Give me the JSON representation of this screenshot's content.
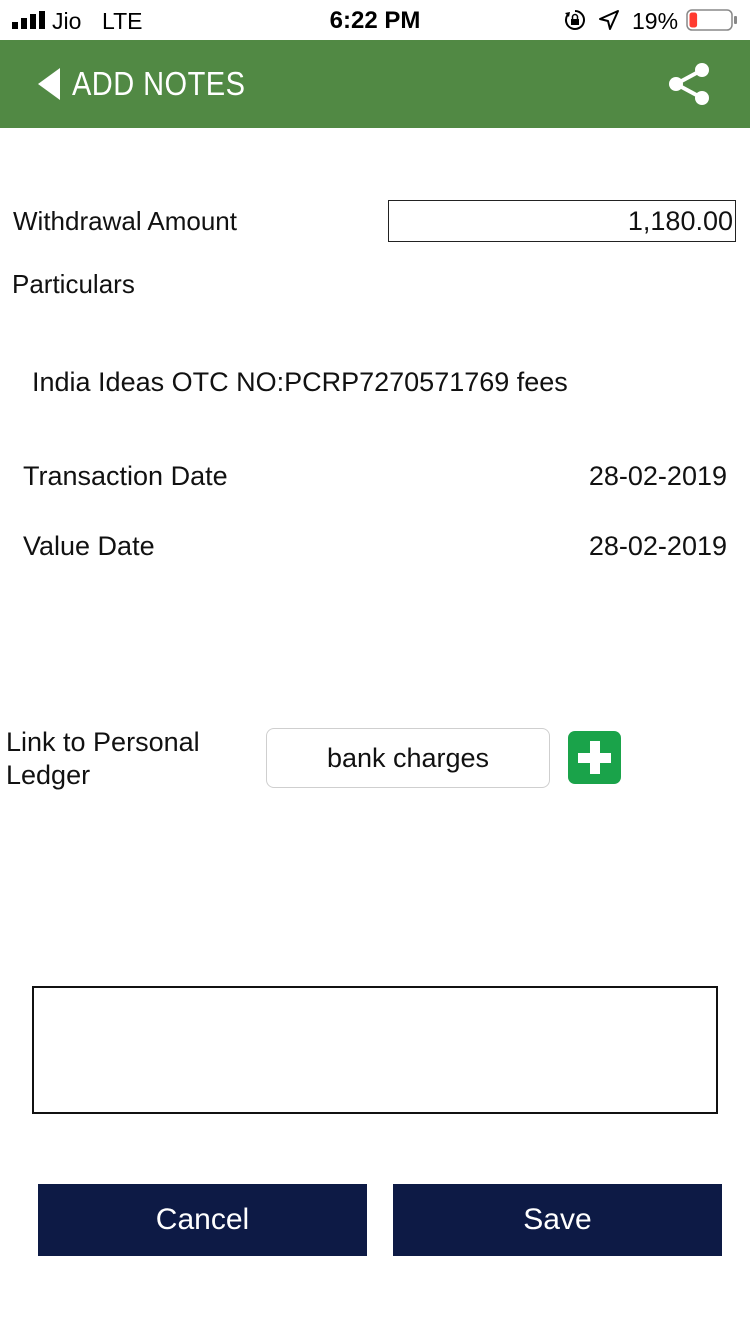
{
  "status_bar": {
    "carrier": "Jio",
    "network": "LTE",
    "time": "6:22 PM",
    "battery_percent": "19%",
    "icons": [
      "signal-bars-icon",
      "rotation-lock-icon",
      "location-arrow-icon",
      "battery-icon"
    ],
    "battery_level": 0.19,
    "battery_color": "#ff3b30"
  },
  "nav": {
    "title": "ADD NOTES",
    "back_icon": "back-arrow-icon",
    "share_icon": "share-icon",
    "background_color": "#518944"
  },
  "form": {
    "withdrawal_label": "Withdrawal Amount",
    "withdrawal_value": "1,180.00",
    "particulars_label": "Particulars",
    "particulars_value": "India Ideas OTC NO:PCRP7270571769 fees",
    "transaction_date_label": "Transaction Date",
    "transaction_date_value": "28-02-2019",
    "value_date_label": "Value Date",
    "value_date_value": "28-02-2019",
    "ledger_label_line1": "Link to Personal",
    "ledger_label_line2": "Ledger",
    "ledger_value": "bank charges",
    "add_icon": "plus-icon",
    "add_color": "#1aa34a",
    "notes_value": "",
    "notes_placeholder": ""
  },
  "actions": {
    "cancel_label": "Cancel",
    "save_label": "Save",
    "button_color": "#0d1a45"
  }
}
